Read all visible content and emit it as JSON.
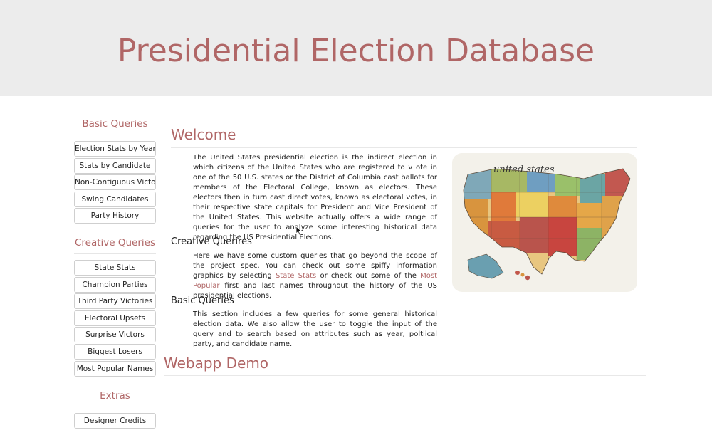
{
  "header": {
    "title": "Presidential Election Database"
  },
  "sidebar": {
    "basic": {
      "heading": "Basic Queries",
      "items": [
        "Election Stats by Year",
        "Stats by Candidate",
        "Non-Contiguous Victors",
        "Swing Candidates",
        "Party History"
      ]
    },
    "creative": {
      "heading": "Creative Queries",
      "items": [
        "State Stats",
        "Champion Parties",
        "Third Party Victories",
        "Electoral Upsets",
        "Surprise Victors",
        "Biggest Losers",
        "Most Popular Names"
      ]
    },
    "extras": {
      "heading": "Extras",
      "items": [
        "Designer Credits"
      ]
    }
  },
  "main": {
    "welcome_title": "Welcome",
    "welcome_text": "The United States presidential election is the indirect election in which citizens of the United States who are registered to v ote in one of the 50 U.S. states or the District of Columbia cast ballots for members of the Electoral College, known as electors. These electors then in turn cast direct votes, known as electoral votes, in their respective state capitals for President and Vice President of the United States. This website actually offers a wide range of queries for the user to analyze some interesting historical data regarding the US Presidential Elections.",
    "creative_title": "Creative Querires",
    "creative_text_1": "Here we have some custom queries that go beyond the scope of the project spec. You can check out some spiffy information graphics by selecting ",
    "creative_link_1": "State Stats",
    "creative_text_2": " or check out some of the ",
    "creative_link_2": "Most Popular",
    "creative_text_3": " first and last names throughout the history of the US presidential elections.",
    "basic_title": "Basic Queries",
    "basic_text": "This section includes a few queries for some general historical election data. We also allow the user to toggle the input of the query and to search based on attributes such as year, poltiical party, and candidate name.",
    "demo_title": "Webapp Demo",
    "map_caption": "united states"
  },
  "colors": {
    "accent": "#b06666",
    "header_bg": "#ececec"
  }
}
